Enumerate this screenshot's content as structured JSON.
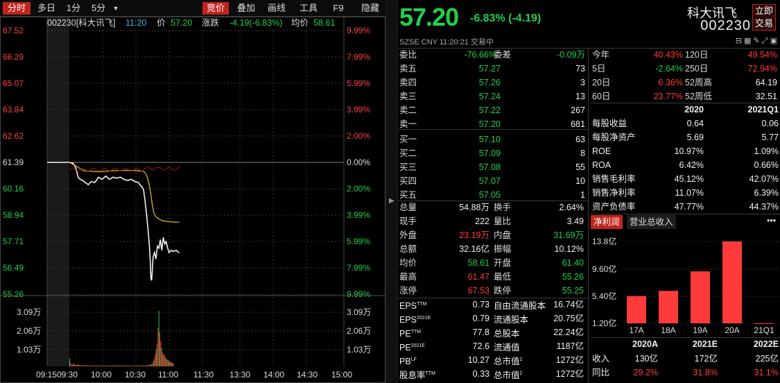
{
  "toolbar": {
    "tabs": [
      "分时",
      "多日",
      "1分",
      "5分"
    ],
    "more_icon": "dropdown-icon",
    "right": [
      "竞价",
      "叠加",
      "画线",
      "工具",
      "F9",
      "隐藏"
    ]
  },
  "chart_header": {
    "code_name": "002230[科大讯飞]",
    "time": "11:20",
    "price_label": "价",
    "price": "57.20",
    "change_label": "涨跌",
    "change": "-4.19(-6.83%)",
    "avg_label": "均价",
    "avg": "58.61"
  },
  "chart_data": {
    "type": "line",
    "prices_axis": [
      "67.52",
      "66.29",
      "65.07",
      "63.84",
      "62.62",
      "61.39",
      "60.16",
      "58.94",
      "57.71",
      "56.49",
      "55.26"
    ],
    "pct_axis": [
      "9.99%",
      "7.99%",
      "5.99%",
      "3.99%",
      "2.00%",
      "0.00%",
      "2.00%",
      "3.99%",
      "5.99%",
      "7.99%",
      "9.99%"
    ],
    "vol_axis": [
      "3.09万",
      "2.06万",
      "1.03万"
    ],
    "time_axis": [
      "09:15",
      "09:30",
      "10:00",
      "10:30",
      "11:00",
      "11:30",
      "13:00",
      "13:30",
      "14:00",
      "14:30",
      "15:00"
    ],
    "prev_close": 61.39,
    "ylim": [
      55.26,
      67.52
    ],
    "price_series": {
      "t": [
        0,
        5,
        8,
        10,
        12,
        15,
        18,
        22,
        26,
        30,
        35,
        40,
        45,
        50,
        55,
        60,
        65,
        70,
        75,
        80,
        85,
        90,
        95,
        98,
        100,
        102,
        104,
        106,
        108,
        110,
        111,
        112,
        113,
        114,
        115,
        117,
        119,
        121,
        123,
        125,
        127,
        129,
        131,
        133,
        135,
        137,
        140,
        143,
        147,
        150,
        151
      ],
      "v": [
        61.39,
        61.35,
        61.2,
        61.0,
        60.7,
        60.6,
        60.55,
        60.45,
        60.35,
        60.5,
        60.45,
        60.7,
        60.6,
        60.75,
        60.6,
        60.7,
        60.65,
        60.7,
        60.6,
        60.55,
        60.6,
        60.5,
        60.45,
        60.3,
        60.25,
        60.1,
        59.6,
        59.0,
        58.3,
        57.5,
        56.9,
        56.0,
        55.9,
        56.4,
        57.0,
        57.2,
        56.9,
        57.5,
        57.4,
        57.8,
        57.3,
        57.9,
        57.6,
        57.7,
        57.4,
        57.2,
        57.3,
        57.25,
        57.3,
        57.2,
        57.2
      ]
    },
    "avg_series": {
      "t": [
        0,
        10,
        20,
        40,
        60,
        80,
        95,
        100,
        103,
        106,
        108,
        110,
        112,
        114,
        116,
        118,
        121,
        125,
        130,
        140,
        151
      ],
      "v": [
        61.39,
        61.2,
        61.0,
        60.95,
        61.0,
        61.02,
        61.0,
        60.98,
        60.95,
        60.8,
        60.6,
        60.3,
        59.9,
        59.4,
        59.05,
        58.9,
        58.8,
        58.72,
        58.66,
        58.62,
        58.61
      ]
    },
    "volume_series": [
      0.5,
      0.25,
      0.12,
      0.1,
      0.15,
      0.2,
      0.1,
      0.08,
      0.1,
      0.12,
      0.1,
      0.08,
      0.07,
      0.06,
      0.08,
      0.06,
      0.05,
      0.07,
      0.08,
      0.06,
      0.05,
      0.06,
      0.05,
      0.04,
      0.06,
      0.05,
      0.06,
      0.07,
      0.05,
      0.04,
      0.05,
      0.06,
      0.05,
      0.04,
      0.05,
      0.04,
      0.05,
      0.06,
      0.04,
      0.05,
      0.04,
      0.05,
      0.06,
      0.04,
      0.05,
      0.05,
      0.04,
      0.06,
      0.05,
      0.04,
      0.06,
      0.07,
      0.05,
      0.06,
      0.05,
      0.06,
      0.05,
      0.04,
      0.06,
      0.05,
      0.04,
      0.06,
      0.05,
      0.07,
      0.06,
      0.05,
      0.05,
      0.06,
      0.04,
      0.05,
      0.06,
      0.05,
      0.05,
      0.04,
      0.05,
      0.06,
      0.05,
      0.04,
      0.05,
      0.06,
      0.05,
      0.07,
      0.06,
      0.05,
      0.06,
      0.05,
      0.08,
      0.07,
      0.06,
      0.1,
      0.12,
      0.15,
      0.2,
      0.35,
      0.55,
      0.8,
      1.1,
      1.5,
      2.5,
      3.6,
      2.2,
      1.6,
      1.2,
      0.9,
      0.7,
      0.8,
      0.6,
      0.5,
      0.45,
      0.4,
      0.35,
      0.3,
      0.28,
      0.25,
      0.22,
      0.2
    ],
    "vol_max": 3.6
  },
  "quote": {
    "price": "57.20",
    "change": "-6.83% (-4.19)",
    "name": "科大讯飞",
    "code": "002230",
    "trade_btn": "立即交易",
    "meta": "SZSE  CNY  11:20:21  交易中"
  },
  "weibi": {
    "label1": "委比",
    "v1": "-76.66%",
    "label2": "委差",
    "v2": "-0.09万"
  },
  "orderbook": [
    {
      "label": "卖五",
      "price": "57.27",
      "vol": "73"
    },
    {
      "label": "卖四",
      "price": "57.26",
      "vol": "3"
    },
    {
      "label": "卖三",
      "price": "57.24",
      "vol": "13"
    },
    {
      "label": "卖二",
      "price": "57.22",
      "vol": "267"
    },
    {
      "label": "卖一",
      "price": "57.20",
      "vol": "681"
    },
    {
      "label": "买一",
      "price": "57.10",
      "vol": "63"
    },
    {
      "label": "买二",
      "price": "57.09",
      "vol": "8"
    },
    {
      "label": "买三",
      "price": "57.08",
      "vol": "55"
    },
    {
      "label": "买四",
      "price": "57.07",
      "vol": "10"
    },
    {
      "label": "买五",
      "price": "57.05",
      "vol": "1"
    }
  ],
  "stats": [
    {
      "l1": "总量",
      "v1": "54.88万",
      "c1": "white",
      "l2": "换手",
      "v2": "2.64%",
      "c2": "white"
    },
    {
      "l1": "现手",
      "v1": "222",
      "c1": "white",
      "l2": "量比",
      "v2": "3.49",
      "c2": "white"
    },
    {
      "l1": "外盘",
      "v1": "23.19万",
      "c1": "red",
      "l2": "内盘",
      "v2": "31.69万",
      "c2": "green"
    },
    {
      "l1": "总额",
      "v1": "32.16亿",
      "c1": "white",
      "l2": "振幅",
      "v2": "10.12%",
      "c2": "white"
    },
    {
      "l1": "均价",
      "v1": "58.61",
      "c1": "green",
      "l2": "开盘",
      "v2": "61.40",
      "c2": "green"
    },
    {
      "l1": "最高",
      "v1": "61.47",
      "c1": "red",
      "l2": "最低",
      "v2": "55.26",
      "c2": "green"
    },
    {
      "l1": "涨停",
      "v1": "67.53",
      "c1": "red",
      "l2": "跌停",
      "v2": "55.25",
      "c2": "green"
    }
  ],
  "fund": [
    {
      "l1": "EPS",
      "s1": "TTM",
      "v1": "0.73",
      "l2": "自由流通股本",
      "s2": "",
      "v2": "16.74亿"
    },
    {
      "l1": "EPS",
      "s1": "2021E",
      "v1": "0.79",
      "l2": "流通股本",
      "s2": "",
      "v2": "20.75亿"
    },
    {
      "l1": "PE",
      "s1": "TTM",
      "v1": "77.8",
      "l2": "总股本",
      "s2": "",
      "v2": "22.24亿"
    },
    {
      "l1": "PE",
      "s1": "2021E",
      "v1": "72.6",
      "l2": "流通值",
      "s2": "",
      "v2": "1187亿"
    },
    {
      "l1": "PB",
      "s1": "LF",
      "v1": "10.27",
      "l2": "总市值",
      "s2": "1",
      "v2": "1272亿"
    },
    {
      "l1": "股息率",
      "s1": "TTM",
      "v1": "0.33",
      "l2": "总市值",
      "s2": "2",
      "v2": "1272亿"
    }
  ],
  "perf": [
    {
      "l1": "今年",
      "v1": "40.43%",
      "c1": "red",
      "l2": "120日",
      "v2": "49.54%",
      "c2": "red"
    },
    {
      "l1": "5日",
      "v1": "-2.64%",
      "c1": "green",
      "l2": "250日",
      "v2": "72.94%",
      "c2": "red"
    },
    {
      "l1": "20日",
      "v1": "6.36%",
      "c1": "red",
      "l2": "52周高",
      "v2": "64.19",
      "c2": "white"
    },
    {
      "l1": "60日",
      "v1": "23.77%",
      "c1": "red",
      "l2": "52周低",
      "v2": "32.51",
      "c2": "white"
    }
  ],
  "fin_head": [
    "2020",
    "2021Q1"
  ],
  "fin": [
    {
      "l": "每股收益",
      "a": "0.64",
      "b": "0.06"
    },
    {
      "l": "每股净资产",
      "a": "5.69",
      "b": "5.77"
    },
    {
      "l": "ROE",
      "a": "10.97%",
      "b": "1.09%"
    },
    {
      "l": "ROA",
      "a": "6.42%",
      "b": "0.66%"
    },
    {
      "l": "销售毛利率",
      "a": "45.12%",
      "b": "42.07%"
    },
    {
      "l": "销售净利率",
      "a": "11.07%",
      "b": "6.39%"
    },
    {
      "l": "资产负债率",
      "a": "47.77%",
      "b": "44.37%"
    }
  ],
  "bar_tabs": [
    "净利润",
    "营业总收入"
  ],
  "bar_chart": {
    "type": "bar",
    "categories": [
      "17A",
      "18A",
      "19A",
      "20A",
      "21Q1"
    ],
    "values": [
      5.4,
      6.2,
      9.2,
      13.8,
      1.2
    ],
    "yticks": [
      "13.8亿",
      "9.60亿",
      "5.40亿",
      "1.20亿"
    ],
    "ylim": [
      1.2,
      13.8
    ],
    "color": "#ff3a3a"
  },
  "forecast": {
    "head": [
      "2020A",
      "2021E",
      "2022E"
    ],
    "rows": [
      {
        "l": "收入",
        "v": [
          "130亿",
          "172亿",
          "225亿"
        ],
        "c": "white"
      },
      {
        "l": "同比",
        "v": [
          "29.2%",
          "31.8%",
          "31.1%"
        ],
        "c": "red"
      }
    ]
  }
}
